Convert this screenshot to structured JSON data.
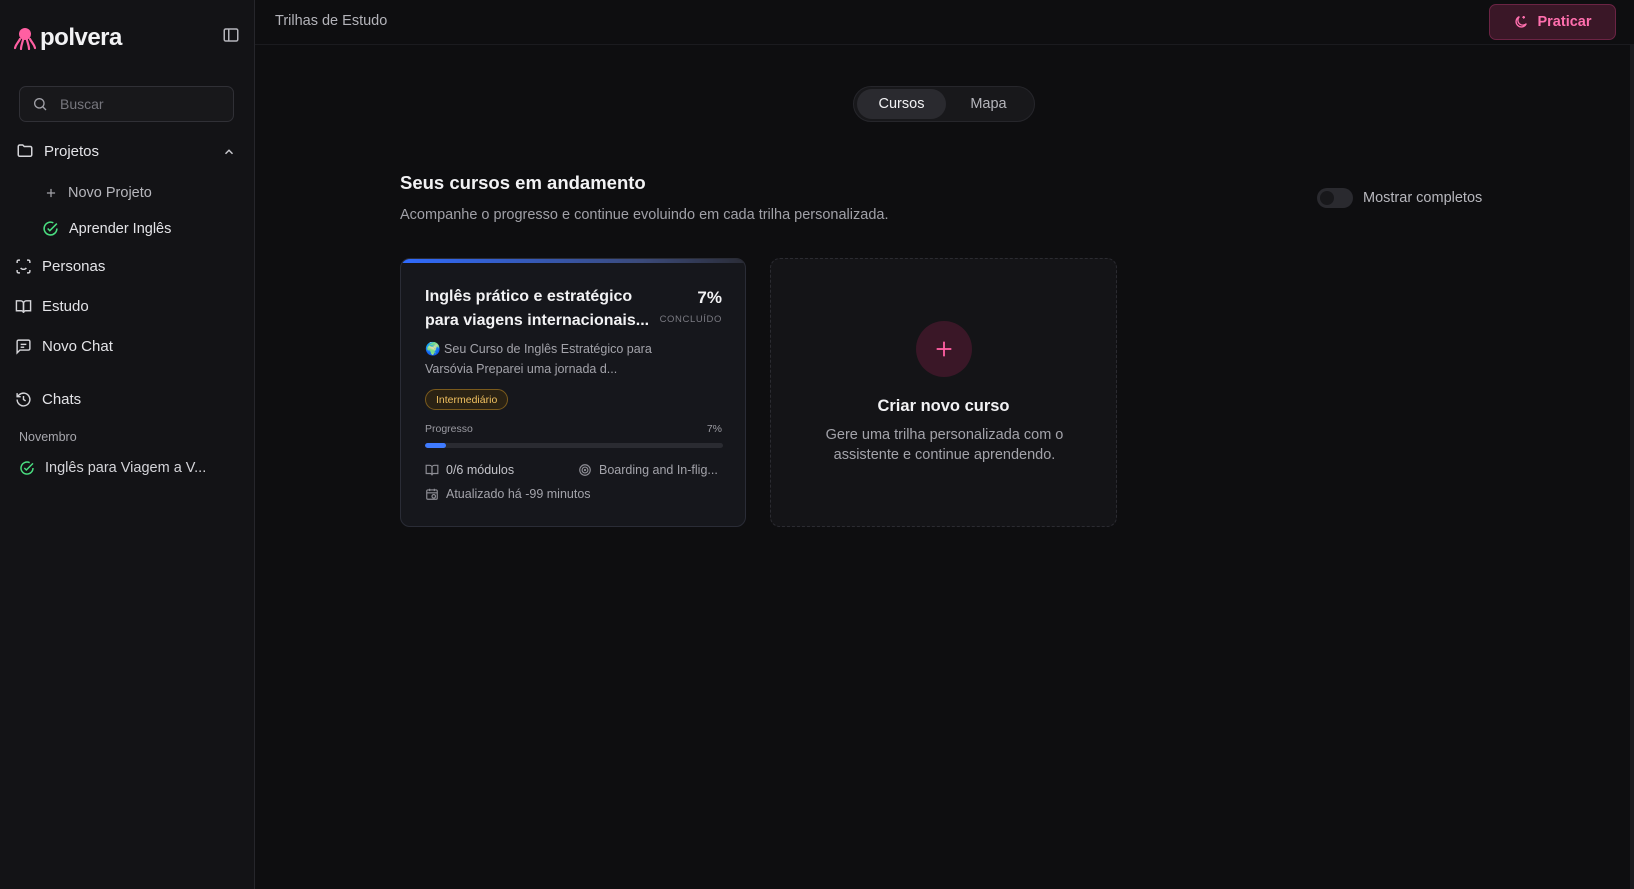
{
  "brand": {
    "name": "polvera",
    "accent": "#ff5fa2"
  },
  "sidebar": {
    "search": {
      "placeholder": "Buscar",
      "value": ""
    },
    "projects": {
      "label": "Projetos",
      "items": [
        {
          "label": "Novo Projeto",
          "icon": "plus-icon"
        },
        {
          "label": "Aprender Inglês",
          "icon": "check-circle-icon"
        }
      ]
    },
    "nav": [
      {
        "label": "Personas",
        "icon": "scan-face-icon"
      },
      {
        "label": "Estudo",
        "icon": "book-open-icon"
      },
      {
        "label": "Novo Chat",
        "icon": "message-square-icon"
      }
    ],
    "chats": {
      "label": "Chats",
      "group": "Novembro",
      "items": [
        {
          "label": "Inglês para Viagem a V...",
          "icon": "check-circle-icon"
        }
      ]
    }
  },
  "header": {
    "title": "Trilhas de Estudo",
    "practice_label": "Praticar"
  },
  "tabs": [
    {
      "label": "Cursos",
      "active": true
    },
    {
      "label": "Mapa",
      "active": false
    }
  ],
  "section": {
    "title": "Seus cursos em andamento",
    "subtitle": "Acompanhe o progresso e continue evoluindo em cada trilha personalizada.",
    "toggle_label": "Mostrar completos",
    "toggle_on": false
  },
  "course": {
    "title": "Inglês prático e estratégico para viagens internacionais...",
    "percent": "7%",
    "percent_label": "CONCLUÍDO",
    "description": "🌍 Seu Curso de Inglês Estratégico para Varsóvia Preparei uma jornada d...",
    "level": "Intermediário",
    "progress_label": "Progresso",
    "progress_value": "7%",
    "progress_fraction": 0.07,
    "modules": "0/6 módulos",
    "current_module": "Boarding and In-flig...",
    "updated": "Atualizado há -99 minutos",
    "accent": "#3f7bff"
  },
  "create": {
    "title": "Criar novo curso",
    "description": "Gere uma trilha personalizada com o assistente e continue aprendendo."
  }
}
